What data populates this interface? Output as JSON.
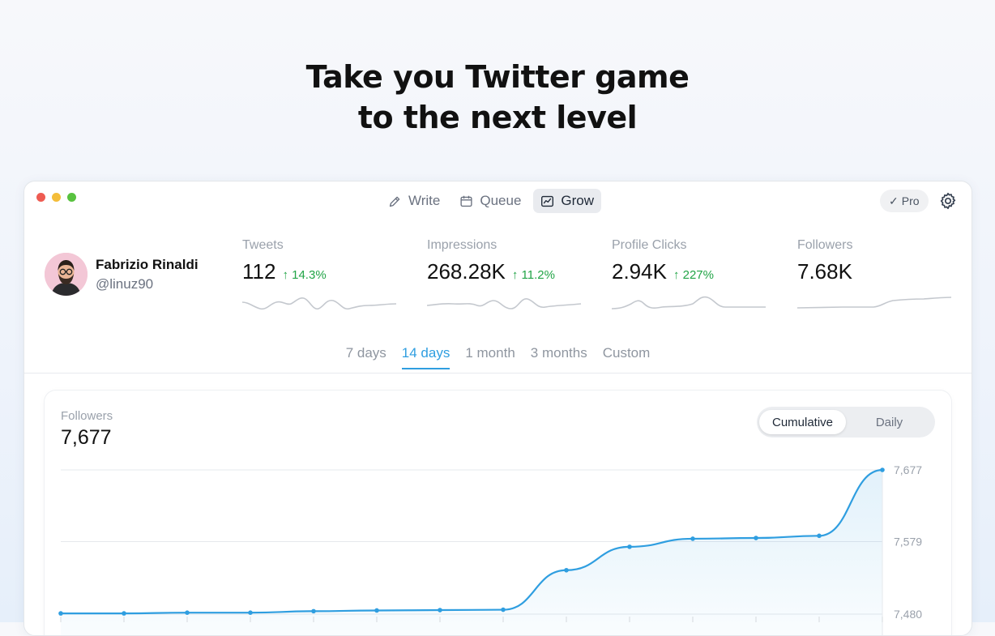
{
  "headline": {
    "line1": "Take you Twitter game",
    "line2": "to the next level"
  },
  "nav": {
    "items": [
      {
        "label": "Write",
        "icon": "pencil-icon",
        "active": false
      },
      {
        "label": "Queue",
        "icon": "calendar-icon",
        "active": false
      },
      {
        "label": "Grow",
        "icon": "chart-icon",
        "active": true
      }
    ]
  },
  "pro_badge": "Pro",
  "profile": {
    "name": "Fabrizio Rinaldi",
    "handle": "@linuz90"
  },
  "stats": [
    {
      "label": "Tweets",
      "value": "112",
      "change": "14.3%"
    },
    {
      "label": "Impressions",
      "value": "268.28K",
      "change": "11.2%"
    },
    {
      "label": "Profile Clicks",
      "value": "2.94K",
      "change": "227%"
    },
    {
      "label": "Followers",
      "value": "7.68K",
      "change": ""
    }
  ],
  "ranges": [
    {
      "label": "7 days",
      "active": false
    },
    {
      "label": "14 days",
      "active": true
    },
    {
      "label": "1 month",
      "active": false
    },
    {
      "label": "3 months",
      "active": false
    },
    {
      "label": "Custom",
      "active": false
    }
  ],
  "chart_panel": {
    "label": "Followers",
    "value": "7,677",
    "toggle": {
      "cumulative": "Cumulative",
      "daily": "Daily",
      "selected": "Cumulative"
    }
  },
  "colors": {
    "accent": "#2f9ee0",
    "positive": "#22a447",
    "sparkline": "#c4c8ce"
  },
  "chart_data": {
    "type": "area",
    "title": "",
    "series": [
      {
        "values": [
          7481,
          7481,
          7482,
          7482,
          7484,
          7485,
          7485.5,
          7486,
          7540,
          7572,
          7583,
          7584,
          7587,
          7677
        ]
      }
    ],
    "y_ticks": [
      "7,677",
      "7,579",
      "7,480"
    ],
    "ylim": [
      7480,
      7677
    ],
    "grid": true
  }
}
